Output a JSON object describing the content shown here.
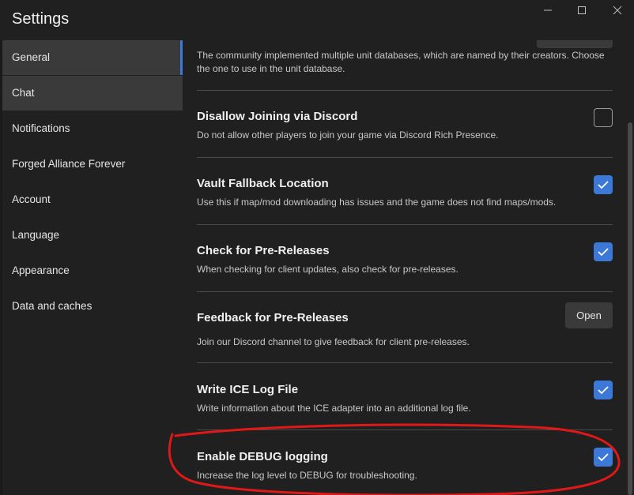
{
  "window": {
    "title": "Settings",
    "controls": [
      "minimize-icon",
      "maximize-icon",
      "close-icon"
    ]
  },
  "sidebar": {
    "items": [
      {
        "label": "General",
        "state": "selected"
      },
      {
        "label": "Chat",
        "state": "hover"
      },
      {
        "label": "Notifications"
      },
      {
        "label": "Forged Alliance Forever"
      },
      {
        "label": "Account"
      },
      {
        "label": "Language"
      },
      {
        "label": "Appearance"
      },
      {
        "label": "Data and caches"
      }
    ]
  },
  "content": {
    "intro_text": "The community implemented multiple unit databases, which are named by their creators. Choose the one to use in the unit database.",
    "settings": [
      {
        "title": "Disallow Joining via Discord",
        "description": "Do not allow other players to join your game via Discord Rich Presence.",
        "control": "checkbox",
        "checked": false
      },
      {
        "title": "Vault Fallback Location",
        "description": "Use this if map/mod downloading has issues and the game does not find maps/mods.",
        "control": "checkbox",
        "checked": true
      },
      {
        "title": "Check for Pre-Releases",
        "description": "When checking for client updates, also check for pre-releases.",
        "control": "checkbox",
        "checked": true
      },
      {
        "title": "Feedback for Pre-Releases",
        "description": "Join our Discord channel to give feedback for client pre-releases.",
        "control": "button",
        "button_label": "Open"
      },
      {
        "title": "Write ICE Log File",
        "description": "Write information about the ICE adapter into an additional log file.",
        "control": "checkbox",
        "checked": true
      },
      {
        "title": "Enable DEBUG logging",
        "description": "Increase the log level to DEBUG for troubleshooting.",
        "control": "checkbox",
        "checked": true
      }
    ]
  },
  "colors": {
    "background": "#202020",
    "selected_nav": "#3a3a3a",
    "accent": "#3b78d8",
    "annotation_red": "#e01818"
  }
}
